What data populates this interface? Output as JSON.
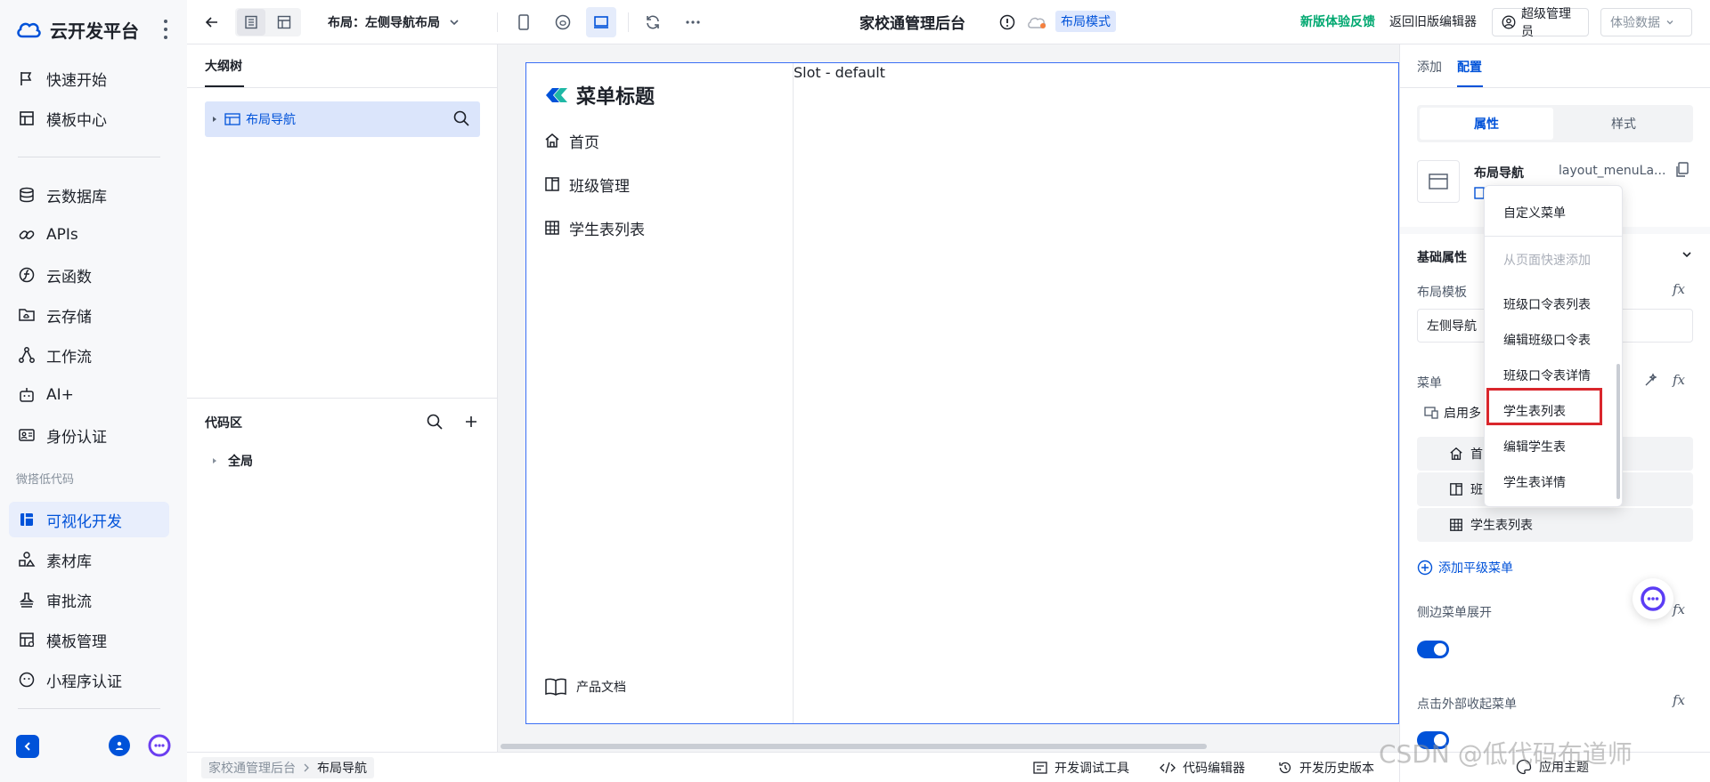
{
  "brand": {
    "name": "云开发平台"
  },
  "nav": {
    "items": [
      {
        "label": "快速开始",
        "icon": "flag-icon"
      },
      {
        "label": "模板中心",
        "icon": "template-icon"
      },
      {
        "label": "云数据库",
        "icon": "database-icon"
      },
      {
        "label": "APIs",
        "icon": "api-icon"
      },
      {
        "label": "云函数",
        "icon": "function-icon"
      },
      {
        "label": "云存储",
        "icon": "cloud-folder-icon"
      },
      {
        "label": "工作流",
        "icon": "workflow-icon"
      },
      {
        "label": "AI+",
        "icon": "robot-icon"
      },
      {
        "label": "身份认证",
        "icon": "id-card-icon"
      }
    ],
    "section_label": "微搭低代码",
    "lowcode_items": [
      {
        "label": "可视化开发",
        "icon": "layout-icon",
        "active": true
      },
      {
        "label": "素材库",
        "icon": "shapes-icon"
      },
      {
        "label": "审批流",
        "icon": "stamp-icon"
      },
      {
        "label": "模板管理",
        "icon": "template-manage-icon"
      },
      {
        "label": "小程序认证",
        "icon": "miniprogram-icon"
      }
    ]
  },
  "topbar": {
    "layout_label": "布局：左侧导航布局",
    "app_title": "家校通管理后台",
    "mode_badge": "布局模式",
    "feedback": "新版体验反馈",
    "old_editor": "返回旧版编辑器",
    "user": "超级管理员",
    "trial_data": "体验数据"
  },
  "outline": {
    "tab": "大纲树",
    "tree_node": "布局导航",
    "code_title": "代码区",
    "code_node": "全局"
  },
  "preview": {
    "menu_title": "菜单标题",
    "menu_items": [
      {
        "label": "首页",
        "icon": "home-icon"
      },
      {
        "label": "班级管理",
        "icon": "book-icon"
      },
      {
        "label": "学生表列表",
        "icon": "table-icon"
      }
    ],
    "slot_text": "Slot - default",
    "doc_link": "产品文档"
  },
  "rightpanel": {
    "tabs": [
      "添加",
      "配置"
    ],
    "active_tab": "配置",
    "segments": [
      "属性",
      "样式"
    ],
    "component_name": "布局导航",
    "component_id": "layout_menuLa...",
    "basic_props": "基础属性",
    "layout_template_label": "布局模板",
    "layout_template_value": "左侧导航",
    "menu_label": "菜单",
    "enable_multi": "启用多",
    "menu_rows": [
      "首",
      "班",
      "学生表列表"
    ],
    "add_menu": "添加平级菜单",
    "side_expand": "侧边菜单展开",
    "click_collapse": "点击外部收起菜单",
    "fx": "fx"
  },
  "dropdown": {
    "items": [
      {
        "label": "自定义菜单",
        "disabled": false
      },
      {
        "label": "从页面快速添加",
        "disabled": true
      },
      {
        "label": "班级口令表列表",
        "disabled": false
      },
      {
        "label": "编辑班级口令表",
        "disabled": false
      },
      {
        "label": "班级口令表详情",
        "disabled": false
      },
      {
        "label": "学生表列表",
        "disabled": false,
        "highlighted": true
      },
      {
        "label": "编辑学生表",
        "disabled": false
      },
      {
        "label": "学生表详情",
        "disabled": false
      }
    ],
    "highlight_color": "#d9262c"
  },
  "statusbar": {
    "breadcrumb": [
      "家校通管理后台",
      "布局导航"
    ],
    "tools": [
      "开发调试工具",
      "代码编辑器",
      "开发历史版本",
      "应用主题"
    ]
  },
  "watermark": "CSDN @低代码布道师",
  "colors": {
    "primary": "#0052d9",
    "feedback_green": "#00a870"
  }
}
